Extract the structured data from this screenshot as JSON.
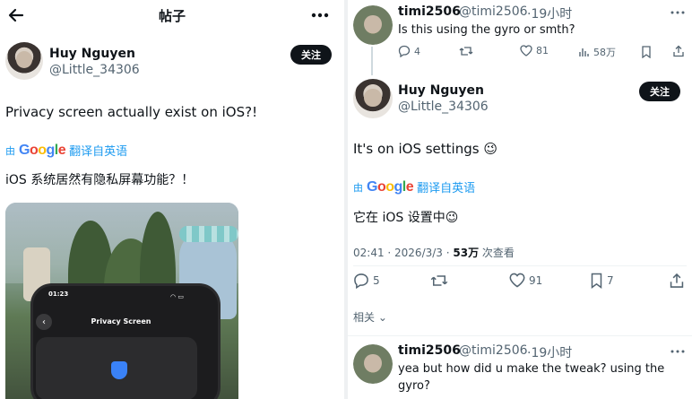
{
  "left": {
    "header": {
      "title": "帖子",
      "back_icon": "arrow-left-icon",
      "more_icon": "more-horizontal-icon"
    },
    "author": {
      "name": "Huy Nguyen",
      "handle": "@Little_34306",
      "follow_label": "关注"
    },
    "post_text": "Privacy screen actually exist on iOS?!",
    "translate": {
      "label": "翻译自英语"
    },
    "translation": "iOS 系统居然有隐私屏幕功能？！",
    "media": {
      "phone_time": "01:23",
      "phone_title": "Privacy Screen"
    }
  },
  "right": {
    "reply_top": {
      "name": "timi2506",
      "handle": "@timi2506",
      "time": "19小时",
      "text": "Is this using the gyro or smth?",
      "actions": {
        "replies": "4",
        "likes": "81",
        "views": "58万"
      }
    },
    "main_reply": {
      "name": "Huy Nguyen",
      "handle": "@Little_34306",
      "follow_label": "关注",
      "text": "It's on iOS settings 😉",
      "translate_label": "翻译自英语",
      "translation": "它在 iOS 设置中😉",
      "timestamp": "02:41 · 2026/3/3 · ",
      "views_count": "53万",
      "views_label": " 次查看",
      "actions": {
        "replies": "5",
        "likes": "91",
        "bookmarks": "7"
      }
    },
    "related_label": "相关",
    "reply_bottom": {
      "name": "timi2506",
      "handle": "@timi2506",
      "time": "19小时",
      "text_line1": "yea but how did u make the tweak? using the",
      "text_line2": "gyro?"
    }
  },
  "colors": {
    "accent": "#1d9bf0",
    "text": "#0f1419",
    "muted": "#536471",
    "follow_bg": "#0f1419"
  }
}
